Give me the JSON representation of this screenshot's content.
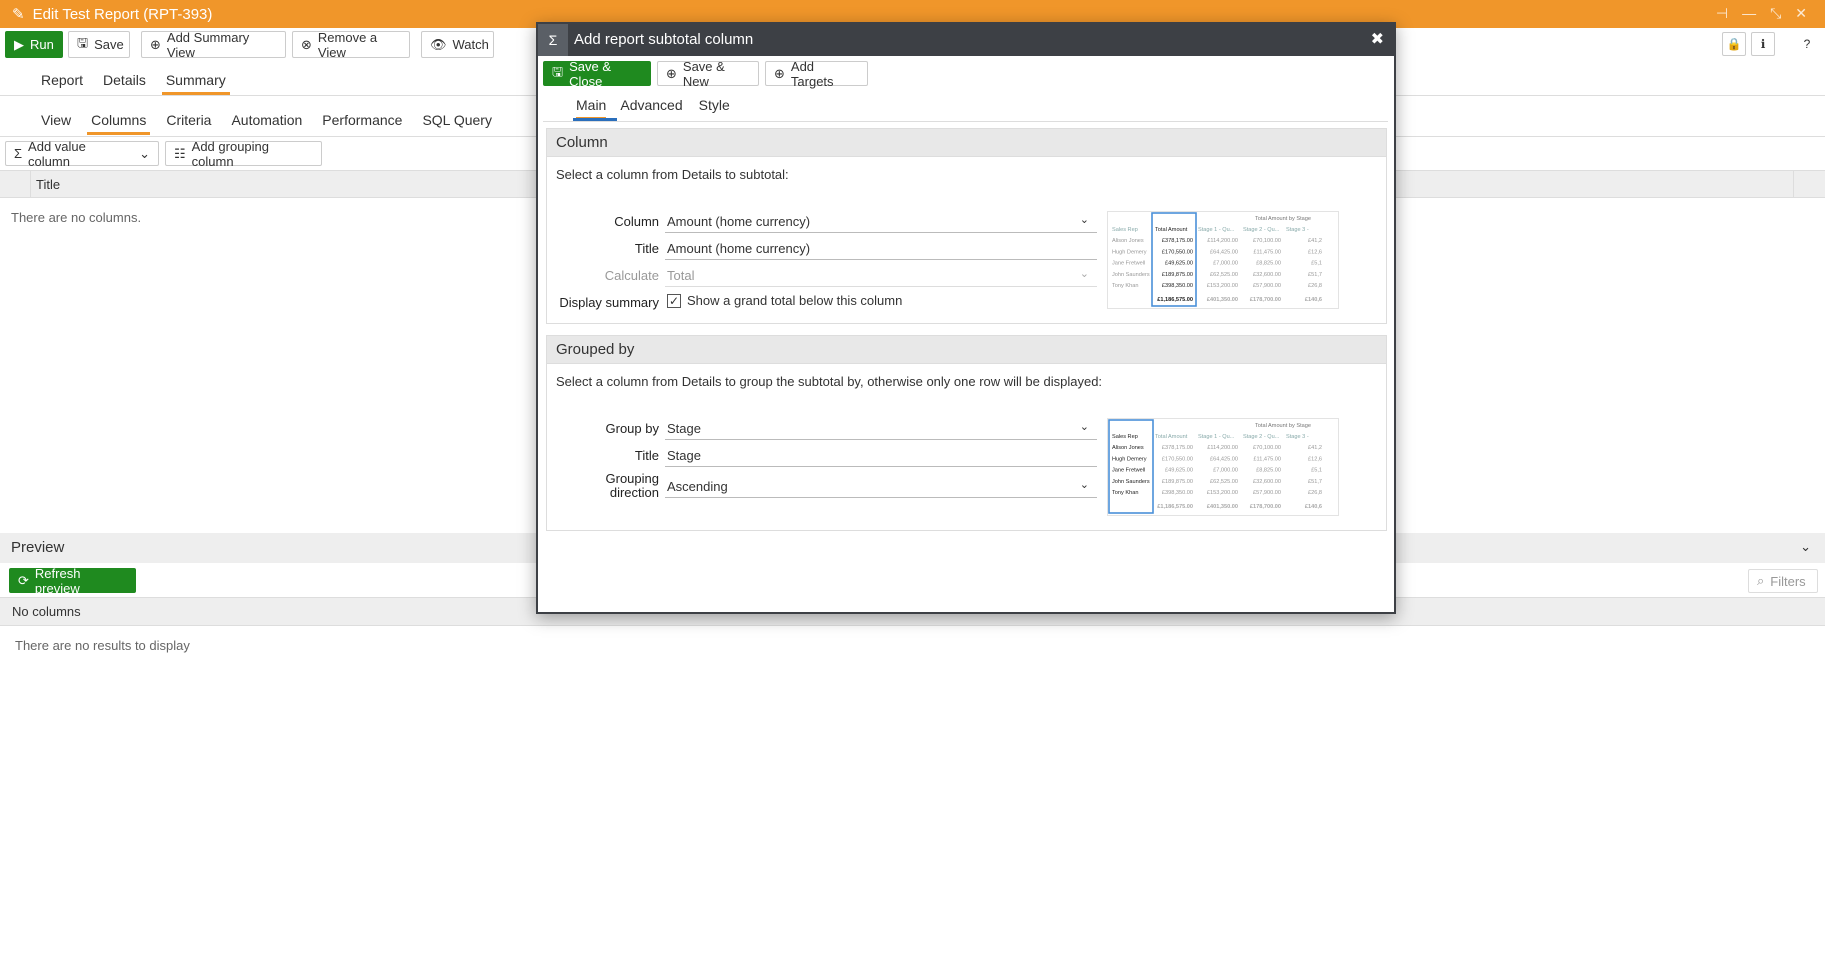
{
  "window": {
    "title": "Edit Test Report (RPT-393)"
  },
  "toolbar": {
    "run": "Run",
    "save": "Save",
    "add_summary_view": "Add Summary View",
    "remove_view": "Remove a View",
    "watch": "Watch"
  },
  "main_tabs": [
    "Report",
    "Details",
    "Summary"
  ],
  "sub_tabs": [
    "View",
    "Columns",
    "Criteria",
    "Automation",
    "Performance",
    "SQL Query"
  ],
  "columns_toolbar": {
    "add_value": "Add value column",
    "add_grouping": "Add grouping column"
  },
  "columns_table": {
    "header": "Title",
    "empty": "There are no columns."
  },
  "preview": {
    "title": "Preview",
    "refresh": "Refresh preview",
    "filters": "Filters",
    "no_columns": "No columns",
    "empty": "There are no results to display"
  },
  "dialog": {
    "title": "Add report subtotal column",
    "buttons": {
      "save_close": "Save & Close",
      "save_new": "Save & New",
      "add_targets": "Add Targets"
    },
    "tabs": [
      "Main",
      "Advanced",
      "Style"
    ],
    "column_panel": {
      "title": "Column",
      "intro": "Select a column from Details to subtotal:",
      "column_label": "Column",
      "column_value": "Amount (home currency)",
      "title_label": "Title",
      "title_value": "Amount (home currency)",
      "calculate_label": "Calculate",
      "calculate_value": "Total",
      "display_summary_label": "Display summary",
      "display_summary_checkbox": "Show a grand total below this column"
    },
    "grouped_panel": {
      "title": "Grouped by",
      "intro": "Select a column from Details to group the subtotal by, otherwise only one row will be displayed:",
      "group_by_label": "Group by",
      "group_by_value": "Stage",
      "title_label": "Title",
      "title_value": "Stage",
      "direction_label": "Grouping direction",
      "direction_value": "Ascending"
    },
    "example_table": {
      "super_header": "Total Amount by Stage",
      "headers": [
        "Sales Rep",
        "Total Amount",
        "Stage 1 - Qu...",
        "Stage 2 - Qu...",
        "Stage 3 -"
      ],
      "rows": [
        [
          "Alison Jones",
          "£378,175.00",
          "£114,200.00",
          "£70,100.00",
          "£41,2"
        ],
        [
          "Hugh Demery",
          "£170,550.00",
          "£64,425.00",
          "£11,475.00",
          "£12,6"
        ],
        [
          "Jane Fretwell",
          "£49,625.00",
          "£7,000.00",
          "£8,825.00",
          "£5,1"
        ],
        [
          "John Saunders",
          "£189,875.00",
          "£62,525.00",
          "£32,600.00",
          "£51,7"
        ],
        [
          "Tony Khan",
          "£398,350.00",
          "£153,200.00",
          "£57,900.00",
          "£26,8"
        ]
      ],
      "totals": [
        "",
        "£1,186,575.00",
        "£401,350.00",
        "£178,700.00",
        "£140,6"
      ]
    }
  }
}
